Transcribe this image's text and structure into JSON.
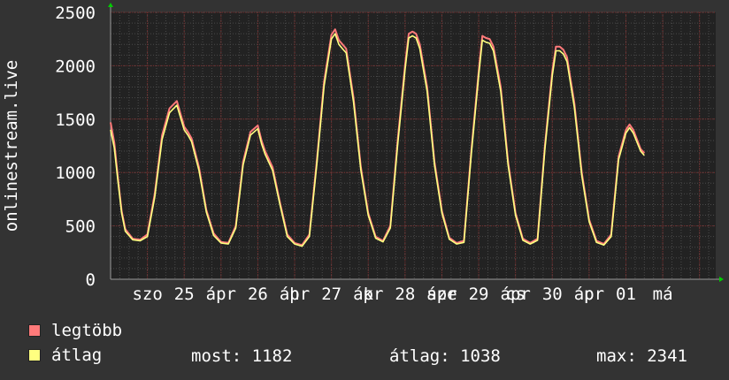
{
  "colors": {
    "background": "#333333",
    "plot_background": "#222222",
    "grid_major": "#7a2b2b",
    "grid_minor": "#4a4a4a",
    "axis": "#999999",
    "text": "#ffffff",
    "arrow": "#00cc00",
    "max_series": "#ff7a7a",
    "avg_series": "#ffff80"
  },
  "legend": {
    "max_label": "legtöbb",
    "avg_label": "átlag"
  },
  "stats": {
    "now": "most: 1182",
    "avg": "átlag: 1038",
    "max": "max: 2341"
  },
  "chart_data": {
    "type": "line",
    "title": "",
    "ylabel": "onlinestream.live",
    "xlabel": "",
    "ylim": [
      0,
      2500
    ],
    "yticks": [
      0,
      500,
      1000,
      1500,
      2000,
      2500
    ],
    "ytick_labels": [
      "0",
      "500",
      "1000",
      "1500",
      "2000",
      "2500"
    ],
    "xlim": [
      0,
      8.22
    ],
    "x_unit": "days",
    "xtick_labels": [
      {
        "x": 0.5,
        "label": "szo"
      },
      {
        "x": 1.0,
        "label": "25"
      },
      {
        "x": 1.5,
        "label": "ápr"
      },
      {
        "x": 2.0,
        "label": "26"
      },
      {
        "x": 2.5,
        "label": "ápr"
      },
      {
        "x": 2.5,
        "label": "h"
      },
      {
        "x": 3.0,
        "label": "27"
      },
      {
        "x": 3.5,
        "label": "ápr"
      },
      {
        "x": 3.5,
        "label": "k"
      },
      {
        "x": 4.0,
        "label": "28"
      },
      {
        "x": 4.5,
        "label": "ápr"
      },
      {
        "x": 4.5,
        "label": "sze"
      },
      {
        "x": 5.0,
        "label": "29"
      },
      {
        "x": 5.5,
        "label": "ápr"
      },
      {
        "x": 5.5,
        "label": "cs"
      },
      {
        "x": 6.0,
        "label": "30"
      },
      {
        "x": 6.5,
        "label": "ápr"
      },
      {
        "x": 6.5,
        "label": "p"
      },
      {
        "x": 7.0,
        "label": "01"
      },
      {
        "x": 7.5,
        "label": "má"
      }
    ],
    "grid": true,
    "series": [
      {
        "name": "legtöbb",
        "x": [
          0,
          0.05,
          0.1,
          0.15,
          0.2,
          0.3,
          0.4,
          0.5,
          0.6,
          0.7,
          0.8,
          0.9,
          1.0,
          1.05,
          1.1,
          1.2,
          1.3,
          1.4,
          1.5,
          1.6,
          1.7,
          1.8,
          1.9,
          2.0,
          2.05,
          2.1,
          2.2,
          2.3,
          2.4,
          2.5,
          2.6,
          2.7,
          2.8,
          2.9,
          3.0,
          3.05,
          3.1,
          3.15,
          3.2,
          3.3,
          3.4,
          3.5,
          3.6,
          3.7,
          3.8,
          3.9,
          4.0,
          4.05,
          4.1,
          4.15,
          4.2,
          4.3,
          4.4,
          4.5,
          4.6,
          4.7,
          4.8,
          4.9,
          5.0,
          5.05,
          5.1,
          5.15,
          5.2,
          5.3,
          5.4,
          5.5,
          5.6,
          5.7,
          5.8,
          5.9,
          6.0,
          6.05,
          6.1,
          6.15,
          6.2,
          6.3,
          6.4,
          6.5,
          6.6,
          6.7,
          6.8,
          6.9,
          7.0,
          7.05,
          7.1,
          7.2,
          7.25
        ],
        "values": [
          1470,
          1280,
          950,
          640,
          470,
          380,
          370,
          420,
          800,
          1350,
          1600,
          1670,
          1430,
          1380,
          1320,
          1050,
          650,
          430,
          350,
          340,
          500,
          1100,
          1380,
          1440,
          1300,
          1200,
          1050,
          720,
          420,
          340,
          320,
          420,
          1100,
          1850,
          2290,
          2341,
          2240,
          2200,
          2160,
          1700,
          1050,
          620,
          400,
          360,
          500,
          1300,
          2000,
          2300,
          2320,
          2300,
          2200,
          1800,
          1100,
          640,
          390,
          340,
          360,
          1200,
          1950,
          2280,
          2260,
          2250,
          2180,
          1800,
          1100,
          620,
          380,
          340,
          380,
          1250,
          1950,
          2180,
          2180,
          2150,
          2080,
          1650,
          1000,
          560,
          360,
          330,
          420,
          1150,
          1400,
          1450,
          1400,
          1220,
          1182
        ]
      },
      {
        "name": "átlag",
        "x": [
          0,
          0.05,
          0.1,
          0.15,
          0.2,
          0.3,
          0.4,
          0.5,
          0.6,
          0.7,
          0.8,
          0.9,
          1.0,
          1.05,
          1.1,
          1.2,
          1.3,
          1.4,
          1.5,
          1.6,
          1.7,
          1.8,
          1.9,
          2.0,
          2.05,
          2.1,
          2.2,
          2.3,
          2.4,
          2.5,
          2.6,
          2.7,
          2.8,
          2.9,
          3.0,
          3.05,
          3.1,
          3.15,
          3.2,
          3.3,
          3.4,
          3.5,
          3.6,
          3.7,
          3.8,
          3.9,
          4.0,
          4.05,
          4.1,
          4.15,
          4.2,
          4.3,
          4.4,
          4.5,
          4.6,
          4.7,
          4.8,
          4.9,
          5.0,
          5.05,
          5.1,
          5.15,
          5.2,
          5.3,
          5.4,
          5.5,
          5.6,
          5.7,
          5.8,
          5.9,
          6.0,
          6.05,
          6.1,
          6.15,
          6.2,
          6.3,
          6.4,
          6.5,
          6.6,
          6.7,
          6.8,
          6.9,
          7.0,
          7.05,
          7.1,
          7.2,
          7.25
        ],
        "values": [
          1400,
          1230,
          920,
          620,
          450,
          370,
          360,
          400,
          770,
          1310,
          1560,
          1630,
          1400,
          1350,
          1290,
          1020,
          630,
          410,
          340,
          330,
          480,
          1070,
          1350,
          1410,
          1270,
          1170,
          1020,
          700,
          400,
          330,
          310,
          400,
          1070,
          1810,
          2250,
          2300,
          2200,
          2160,
          2120,
          1660,
          1020,
          600,
          385,
          350,
          480,
          1260,
          1960,
          2260,
          2280,
          2260,
          2160,
          1760,
          1070,
          620,
          375,
          330,
          345,
          1170,
          1910,
          2240,
          2220,
          2210,
          2140,
          1760,
          1070,
          600,
          365,
          330,
          365,
          1220,
          1910,
          2140,
          2140,
          2110,
          2040,
          1610,
          970,
          540,
          345,
          320,
          400,
          1120,
          1370,
          1420,
          1370,
          1200,
          1160
        ]
      }
    ]
  }
}
